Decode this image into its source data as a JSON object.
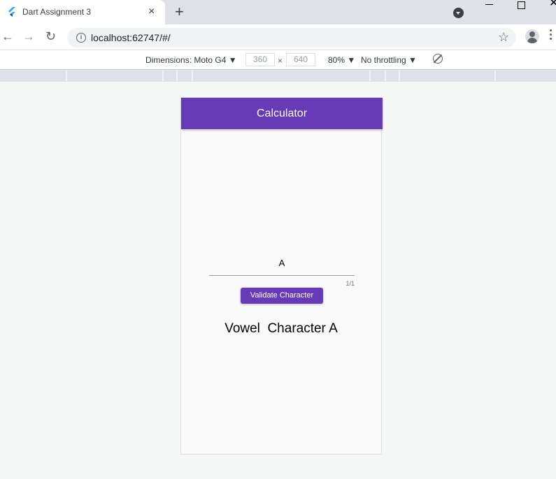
{
  "browser": {
    "tab_title": "Dart Assignment 3",
    "tab_close": "×",
    "new_tab": "+",
    "url": "localhost:62747/#/",
    "back": "←",
    "forward": "→",
    "reload": "↻",
    "star": "☆"
  },
  "devtools": {
    "dimensions_label": "Dimensions: Moto G4",
    "width": "360",
    "times": "×",
    "height": "640",
    "zoom": "80%",
    "throttling": "No throttling"
  },
  "app": {
    "title": "Calculator",
    "input_value": "A",
    "counter": "1/1",
    "button_label": "Validate Character",
    "result": "Vowel  Character A",
    "accent_color": "#673ab7"
  },
  "icons": [
    "flutter-icon",
    "close-icon",
    "plus-icon",
    "profile-menu-icon",
    "minimize-icon",
    "maximize-icon",
    "window-close-icon",
    "back-arrow-icon",
    "forward-arrow-icon",
    "reload-icon",
    "info-icon",
    "star-icon",
    "avatar-icon",
    "more-vert-icon",
    "dropdown-arrow-icon",
    "rotate-icon"
  ]
}
